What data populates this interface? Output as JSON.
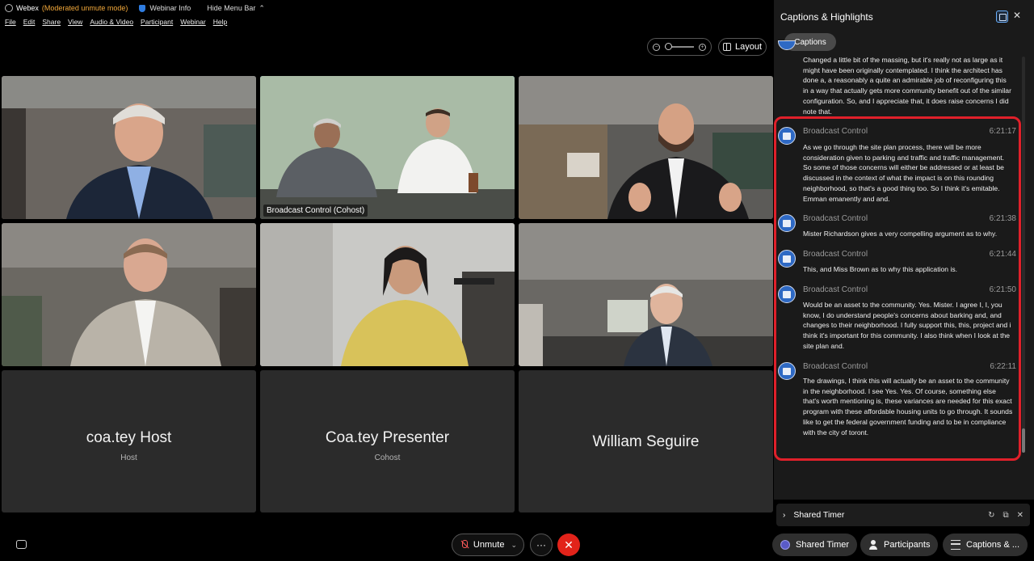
{
  "titlebar": {
    "app_name": "Webex",
    "mode": "(Moderated unmute mode)",
    "webinar_info": "Webinar Info",
    "hide_menu": "Hide Menu Bar",
    "chevron": "⌃"
  },
  "menu": [
    "File",
    "Edit",
    "Share",
    "View",
    "Audio & Video",
    "Participant",
    "Webinar",
    "Help"
  ],
  "view_controls": {
    "layout_label": "Layout",
    "zoom_out_glyph": "−",
    "zoom_in_glyph": "+"
  },
  "video_tiles": [
    {
      "name": "",
      "active": false
    },
    {
      "name": "Broadcast Control (Cohost)",
      "active": true
    },
    {
      "name": "",
      "active": false
    },
    {
      "name": "",
      "active": false
    },
    {
      "name": "",
      "active": false
    },
    {
      "name": "",
      "active": false
    }
  ],
  "name_tiles": [
    {
      "name": "coa.tey Host",
      "role": "Host"
    },
    {
      "name": "Coa.tey Presenter",
      "role": "Cohost"
    },
    {
      "name": "William Seguire",
      "role": ""
    }
  ],
  "panel": {
    "title": "Captions & Highlights",
    "close_glyph": "✕",
    "tab_captions": "Captions",
    "captions": [
      {
        "speaker": "",
        "time": "",
        "text": "Changed a little bit of the massing, but it's really not as large as it might have been originally contemplated. I think the architect has done a, a reasonably a quite an admirable job of reconfiguring this in a way that actually gets more community benefit out of the similar configuration. So, and I appreciate that, it does raise concerns I did note that."
      },
      {
        "speaker": "Broadcast Control",
        "time": "6:21:17",
        "text": "As we go through the site plan process, there will be more consideration given to parking and traffic and traffic management. So some of those concerns will either be addressed or at least be discussed in the context of what the impact is on this rounding neighborhood, so that's a good thing too. So I think it's emitable. Emman emanently and and."
      },
      {
        "speaker": "Broadcast Control",
        "time": "6:21:38",
        "text": "Mister Richardson gives a very compelling argument as to why."
      },
      {
        "speaker": "Broadcast Control",
        "time": "6:21:44",
        "text": "This, and Miss Brown as to why this application is."
      },
      {
        "speaker": "Broadcast Control",
        "time": "6:21:50",
        "text": "Would be an asset to the community. Yes. Mister. I agree I, I, you know, I do understand people's concerns about barking and, and changes to their neighborhood. I fully support this, this, project and i think it's important for this community. I also think when I look at the site plan and."
      },
      {
        "speaker": "Broadcast Control",
        "time": "6:22:11",
        "text": "The drawings, I think this will actually be an asset to the community in the neighborhood. I see Yes. Yes. Of course, something else that's worth mentioning is, these variances are needed for this exact program with these affordable housing units to go through. It sounds like to get the federal government funding and to be in compliance with the city of toront."
      }
    ]
  },
  "shared_timer_row": {
    "label": "Shared Timer",
    "chevron": "›",
    "refresh_glyph": "↻",
    "popout_glyph": "⧉",
    "close_glyph": "✕"
  },
  "bottom": {
    "unmute_label": "Unmute",
    "dropdown_glyph": "⌄",
    "more_glyph": "···",
    "leave_glyph": "✕",
    "shared_timer_label": "Shared Timer",
    "participants_label": "Participants",
    "captions_label": "Captions & ..."
  }
}
